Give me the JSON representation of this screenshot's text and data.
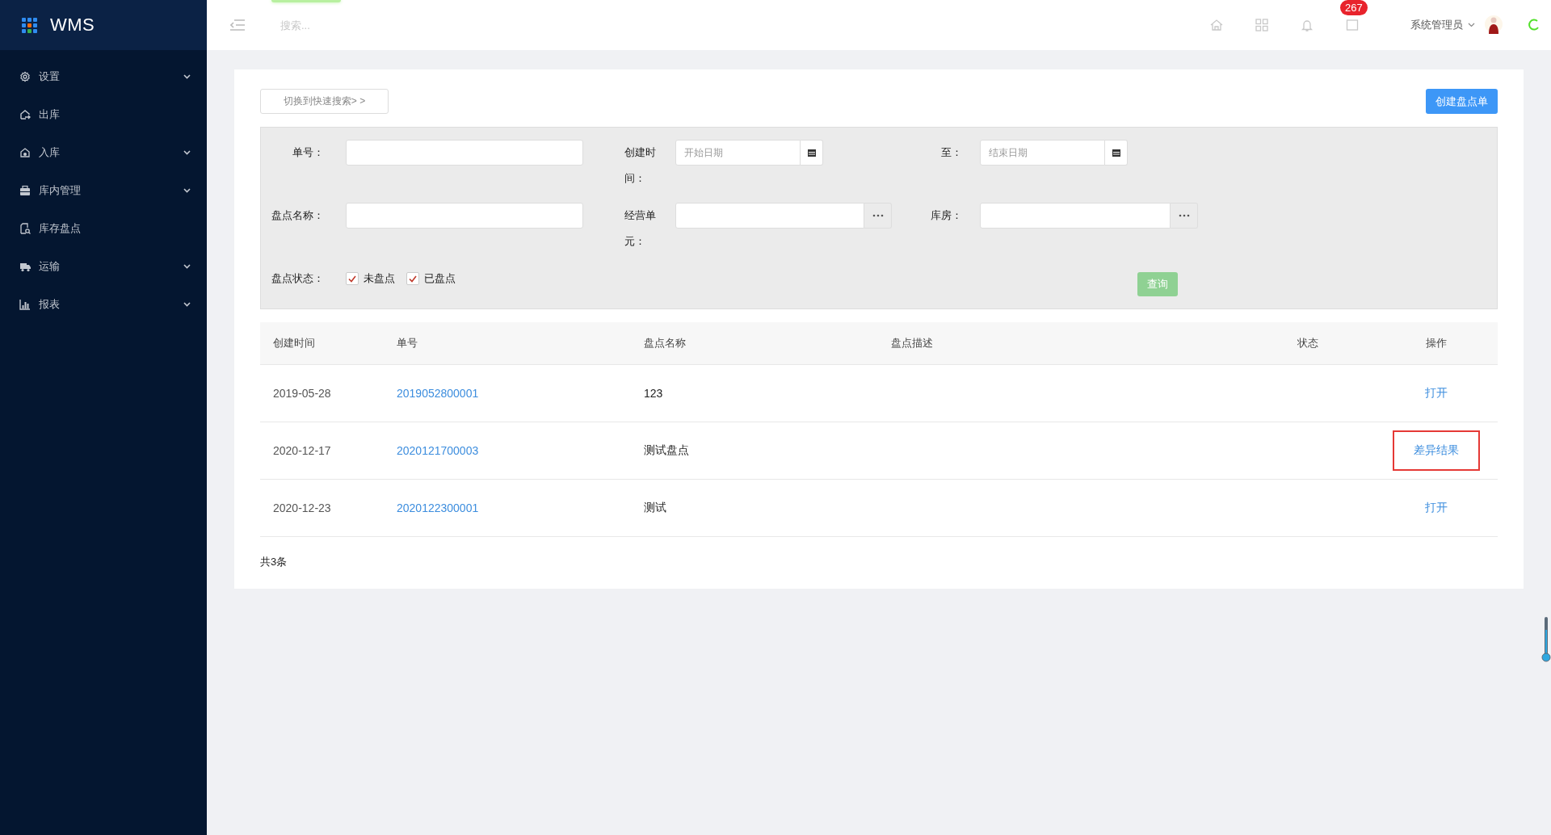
{
  "app": {
    "title": "WMS"
  },
  "sidebar": {
    "items": [
      {
        "label": "设置",
        "expandable": true
      },
      {
        "label": "出库",
        "expandable": false
      },
      {
        "label": "入库",
        "expandable": true
      },
      {
        "label": "库内管理",
        "expandable": true
      },
      {
        "label": "库存盘点",
        "expandable": false
      },
      {
        "label": "运输",
        "expandable": true
      },
      {
        "label": "报表",
        "expandable": true
      }
    ]
  },
  "header": {
    "search": {
      "placeholder": "搜索..."
    },
    "mail_badge": "267",
    "user": "系统管理员"
  },
  "toolbar": {
    "switch_button": "切换到快速搜索> >",
    "create_button": "创建盘点单"
  },
  "filters": {
    "fields": [
      {
        "kind": "text",
        "label": "单号："
      },
      {
        "kind": "date",
        "label": "创建时间：",
        "placeholder": "开始日期"
      },
      {
        "kind": "date",
        "label": "至：",
        "placeholder": "结束日期"
      },
      {
        "kind": "text",
        "label": "盘点名称："
      },
      {
        "kind": "picker",
        "label": "经营单元："
      },
      {
        "kind": "picker",
        "label": "库房："
      },
      {
        "kind": "checks",
        "label": "盘点状态：",
        "options": [
          {
            "label": "未盘点",
            "checked": true
          },
          {
            "label": "已盘点",
            "checked": true
          }
        ]
      }
    ],
    "query_button": "查询"
  },
  "table": {
    "columns": [
      "创建时间",
      "单号",
      "盘点名称",
      "盘点描述",
      "状态",
      "操作"
    ],
    "rows": [
      {
        "created": "2019-05-28",
        "number": "2019052800001",
        "name": "123",
        "action": {
          "label": "打开",
          "highlighted": false
        }
      },
      {
        "created": "2020-12-17",
        "number": "2020121700003",
        "name": "测试盘点",
        "action": {
          "label": "差异结果",
          "highlighted": true
        }
      },
      {
        "created": "2020-12-23",
        "number": "2020122300001",
        "name": "测试",
        "action": {
          "label": "打开",
          "highlighted": false
        }
      }
    ]
  },
  "footer": {
    "total": "共3条"
  }
}
